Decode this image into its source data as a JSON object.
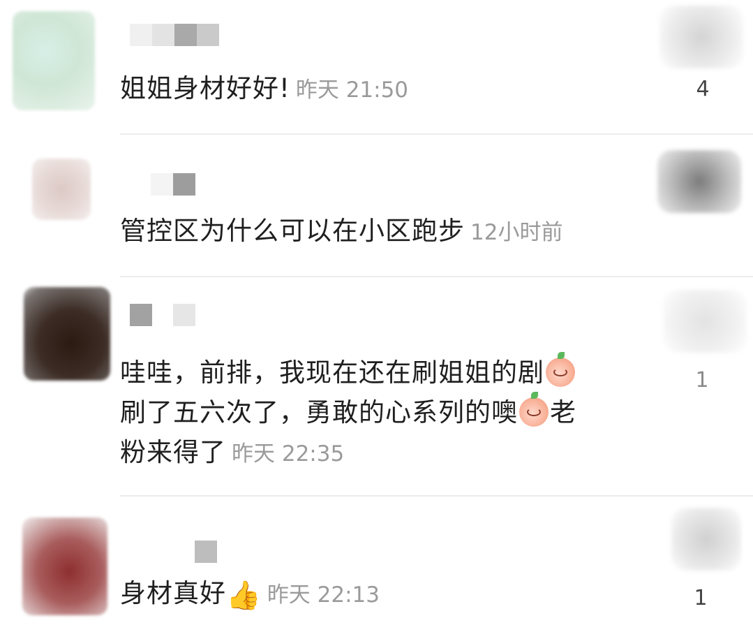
{
  "comments": [
    {
      "text": "姐姐身材好好!",
      "time": "昨天 21:50",
      "likes": "4",
      "avatar_color": "#cfe8d8",
      "name_blocks": [
        "#f0f0f0",
        "#e3e3e3",
        "#a9a9a9",
        "#cacaca"
      ]
    },
    {
      "text": "管控区为什么可以在小区跑步",
      "time": "12小时前",
      "likes": "",
      "avatar_color": "#e5d5d2",
      "name_blocks": [
        "#f4f4f4",
        "#9d9d9d"
      ]
    },
    {
      "text_part1": "哇哇，前排，我现在还在刷姐姐的剧",
      "text_part2": "刷了五六次了，勇敢的心系列的噢",
      "text_part3": "老",
      "text_part4": "粉来得了",
      "time": "昨天 22:35",
      "likes": "1",
      "avatar_color": "#3a2a22",
      "name_blocks": [
        "#a2a2a2",
        "#e6e6e6"
      ]
    },
    {
      "text": "身材真好",
      "time": "昨天 22:13",
      "likes": "1",
      "avatar_color": "#9a3b3b",
      "name_blocks": [
        "#bdbdbd"
      ],
      "emoji": "👍"
    }
  ]
}
